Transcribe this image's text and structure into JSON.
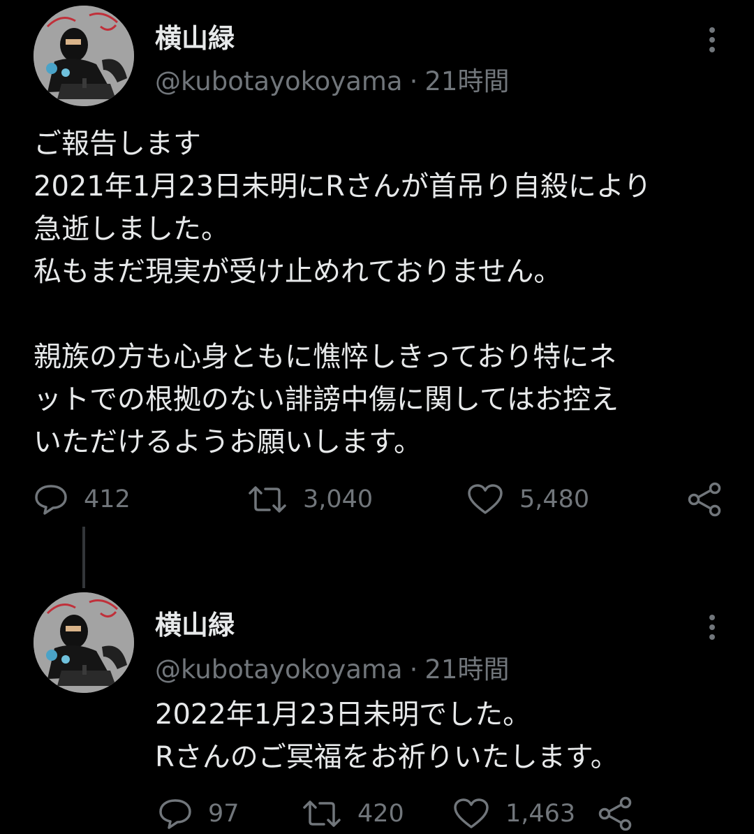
{
  "tweets": [
    {
      "display_name": "横山緑",
      "handle": "@kubotayokoyama",
      "separator": "·",
      "time": "21時間",
      "body_lines": [
        "ご報告します",
        "2021年1月23日未明にRさんが首吊り自殺により",
        "急逝しました。",
        "私もまだ現実が受け止めれておりません。",
        "",
        "親族の方も心身ともに憔悴しきっており特にネ",
        "ットでの根拠のない誹謗中傷に関してはお控え",
        "いただけるようお願いします。"
      ],
      "replies": "412",
      "retweets": "3,040",
      "likes": "5,480"
    },
    {
      "display_name": "横山緑",
      "handle": "@kubotayokoyama",
      "separator": "·",
      "time": "21時間",
      "body_lines": [
        "2022年1月23日未明でした。",
        "Rさんのご冥福をお祈りいたします。"
      ],
      "replies": "97",
      "retweets": "420",
      "likes": "1,463"
    }
  ],
  "icons": {
    "more": "more-vertical-icon",
    "reply": "reply-icon",
    "retweet": "retweet-icon",
    "like": "like-icon",
    "share": "share-icon"
  },
  "colors": {
    "background": "#000000",
    "primary_text": "#e7e9ea",
    "secondary_text": "#71767b",
    "thread_line": "#333639"
  }
}
